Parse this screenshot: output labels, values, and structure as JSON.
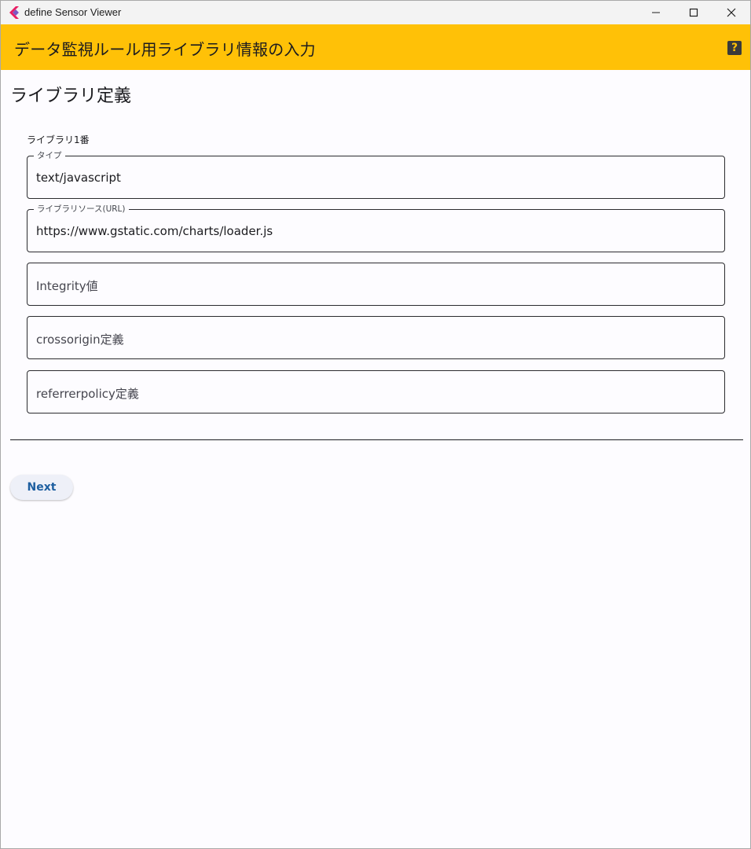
{
  "window": {
    "title": "define Sensor Viewer",
    "controls": {
      "minimize": "minimize-icon",
      "maximize": "maximize-icon",
      "close": "close-icon"
    }
  },
  "appbar": {
    "title": "データ監視ルール用ライブラリ情報の入力",
    "background": "#ffc107",
    "help_label": "?"
  },
  "main": {
    "section_title": "ライブラリ定義",
    "library": {
      "label": "ライブラリ1番",
      "fields": [
        {
          "legend": "タイプ",
          "value": "text/javascript"
        },
        {
          "legend": "ライブラリソース(URL)",
          "value": "https://www.gstatic.com/charts/loader.js"
        },
        {
          "placeholder": "Integrity値",
          "value": ""
        },
        {
          "placeholder": "crossorigin定義",
          "value": ""
        },
        {
          "placeholder": "referrerpolicy定義",
          "value": ""
        }
      ]
    },
    "next_button": "Next"
  }
}
